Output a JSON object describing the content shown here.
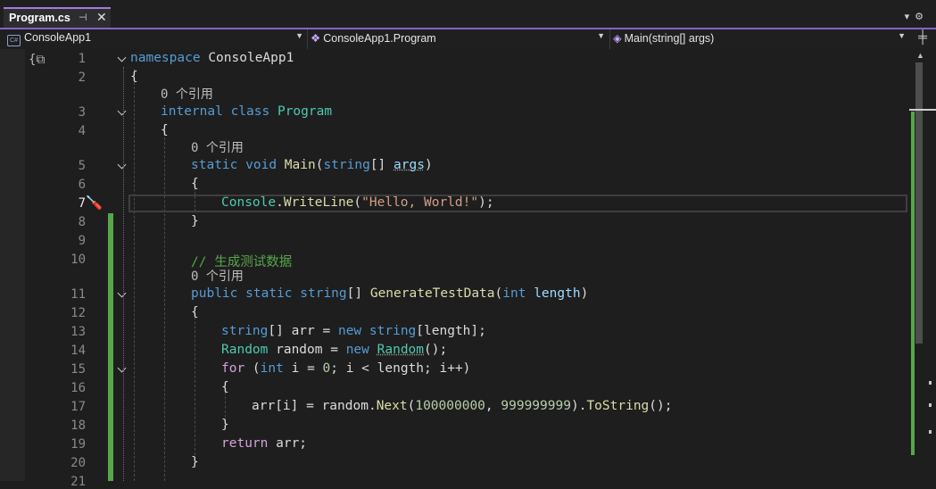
{
  "tab": {
    "title": "Program.cs",
    "pin_icon": "pin-icon",
    "close_glyph": "✕"
  },
  "nav": {
    "project": "ConsoleApp1",
    "type": "ConsoleApp1.Program",
    "member": "Main(string[] args)"
  },
  "line_numbers": [
    "1",
    "2",
    "3",
    "4",
    "5",
    "6",
    "7",
    "8",
    "9",
    "10",
    "11",
    "12",
    "13",
    "14",
    "15",
    "16",
    "17",
    "18",
    "19",
    "20",
    "21"
  ],
  "references": "0 个引用",
  "code": {
    "l1_kw": "namespace",
    "l1_name": "ConsoleApp1",
    "l2": "{",
    "l3_kw1": "internal",
    "l3_kw2": "class",
    "l3_type": "Program",
    "l4": "{",
    "l5_kw1": "static",
    "l5_kw2": "void",
    "l5_method": "Main",
    "l5_p1": "(",
    "l5_kw3": "string",
    "l5_p2": "[] ",
    "l5_arg": "args",
    "l5_p3": ")",
    "l6": "{",
    "l7_type": "Console",
    "l7_dot": ".",
    "l7_method": "WriteLine",
    "l7_p1": "(",
    "l7_str": "\"Hello, World!\"",
    "l7_p2": ");",
    "l8": "}",
    "l10_comment": "// 生成测试数据",
    "l11_kw1": "public",
    "l11_kw2": "static",
    "l11_kw3": "string",
    "l11_p1": "[] ",
    "l11_method": "GenerateTestData",
    "l11_p2": "(",
    "l11_kw4": "int",
    "l11_arg": " length",
    "l11_p3": ")",
    "l12": "{",
    "l13_kw1": "string",
    "l13_p1": "[] arr = ",
    "l13_kw2": "new",
    "l13_p2": " ",
    "l13_kw3": "string",
    "l13_p3": "[length];",
    "l14_type1": "Random",
    "l14_p1": " random = ",
    "l14_kw": "new",
    "l14_p2": " ",
    "l14_type2": "Random",
    "l14_p3": "();",
    "l15_kw1": "for",
    "l15_p1": " (",
    "l15_kw2": "int",
    "l15_p2": " i = ",
    "l15_num": "0",
    "l15_p3": "; i < length; i++)",
    "l16": "{",
    "l17_p1": "arr[i] = random.",
    "l17_m1": "Next",
    "l17_p2": "(",
    "l17_n1": "100000000",
    "l17_p3": ", ",
    "l17_n2": "999999999",
    "l17_p4": ").",
    "l17_m2": "ToString",
    "l17_p5": "();",
    "l18": "}",
    "l19_kw": "return",
    "l19_p": " arr;",
    "l20": "}"
  }
}
